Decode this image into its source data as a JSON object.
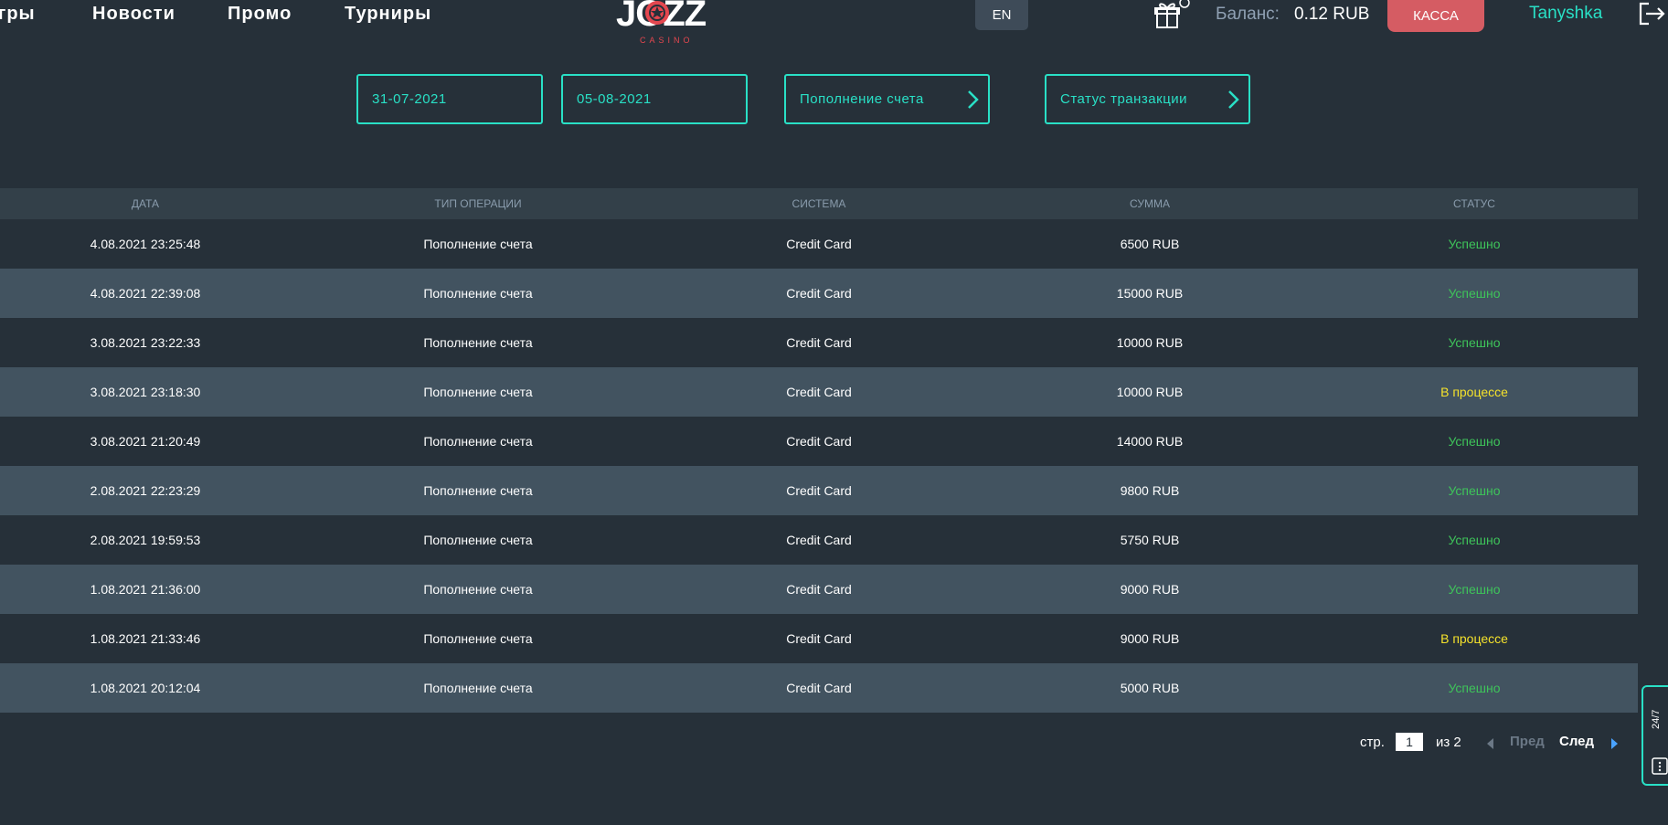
{
  "header": {
    "nav": [
      "гры",
      "Новости",
      "Промо",
      "Турниры"
    ],
    "logo_text": "JOZZ",
    "logo_subtext": "CASINO",
    "lang": "EN",
    "balance_label": "Баланс:",
    "balance_value": "0.12  RUB",
    "kassa_label": "КАССА",
    "username": "Tanyshka"
  },
  "filters": {
    "date_from": "31-07-2021",
    "date_to": "05-08-2021",
    "operation_type": "Пополнение счета",
    "transaction_status": "Статус транзакции"
  },
  "table": {
    "columns": [
      "ДАТА",
      "ТИП ОПЕРАЦИИ",
      "СИСТЕМА",
      "СУММА",
      "СТАТУС"
    ],
    "rows": [
      {
        "date": "4.08.2021 23:25:48",
        "type": "Пополнение счета",
        "system": "Credit Card",
        "amount": "6500 RUB",
        "status": "Успешно",
        "state": "ok"
      },
      {
        "date": "4.08.2021 22:39:08",
        "type": "Пополнение счета",
        "system": "Credit Card",
        "amount": "15000 RUB",
        "status": "Успешно",
        "state": "ok"
      },
      {
        "date": "3.08.2021 23:22:33",
        "type": "Пополнение счета",
        "system": "Credit Card",
        "amount": "10000 RUB",
        "status": "Успешно",
        "state": "ok"
      },
      {
        "date": "3.08.2021 23:18:30",
        "type": "Пополнение счета",
        "system": "Credit Card",
        "amount": "10000 RUB",
        "status": "В процессе",
        "state": "pending"
      },
      {
        "date": "3.08.2021 21:20:49",
        "type": "Пополнение счета",
        "system": "Credit Card",
        "amount": "14000 RUB",
        "status": "Успешно",
        "state": "ok"
      },
      {
        "date": "2.08.2021 22:23:29",
        "type": "Пополнение счета",
        "system": "Credit Card",
        "amount": "9800 RUB",
        "status": "Успешно",
        "state": "ok"
      },
      {
        "date": "2.08.2021 19:59:53",
        "type": "Пополнение счета",
        "system": "Credit Card",
        "amount": "5750 RUB",
        "status": "Успешно",
        "state": "ok"
      },
      {
        "date": "1.08.2021 21:36:00",
        "type": "Пополнение счета",
        "system": "Credit Card",
        "amount": "9000 RUB",
        "status": "Успешно",
        "state": "ok"
      },
      {
        "date": "1.08.2021 21:33:46",
        "type": "Пополнение счета",
        "system": "Credit Card",
        "amount": "9000 RUB",
        "status": "В процессе",
        "state": "pending"
      },
      {
        "date": "1.08.2021 20:12:04",
        "type": "Пополнение счета",
        "system": "Credit Card",
        "amount": "5000 RUB",
        "status": "Успешно",
        "state": "ok"
      }
    ]
  },
  "pagination": {
    "page_label": "стр.",
    "current_page": "1",
    "of_label": "из 2",
    "prev_label": "Пред",
    "next_label": "След"
  },
  "support": {
    "label": "24/7"
  },
  "colors": {
    "background": "#263039",
    "accent": "#29e0c6",
    "kassa": "#d55c63",
    "status_ok": "#3ec45a",
    "status_pending": "#f5e22b"
  },
  "icons": [
    "gift-icon",
    "logout-icon",
    "chevron-right-icon",
    "chat-icon"
  ]
}
